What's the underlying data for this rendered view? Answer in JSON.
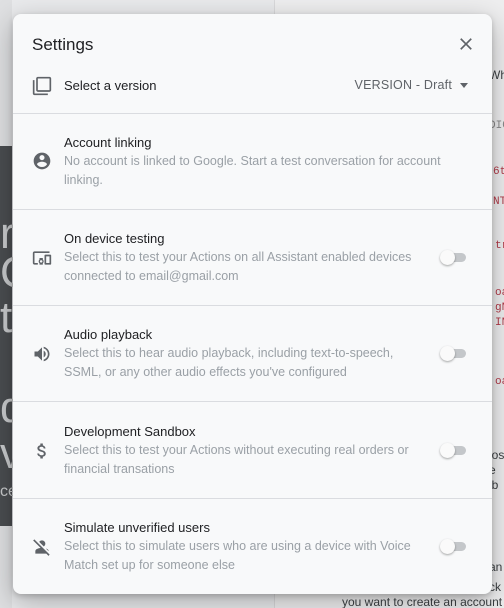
{
  "background": {
    "right_snippets": [
      {
        "text": "Wh",
        "kind": "text"
      },
      {
        "text": "DIC",
        "kind": "code-gray"
      },
      {
        "text": "6t",
        "kind": "code"
      },
      {
        "text": "NT",
        "kind": "code"
      },
      {
        "text": "tr",
        "kind": "code"
      },
      {
        "text": "oa",
        "kind": "code"
      },
      {
        "text": "gN",
        "kind": "code"
      },
      {
        "text": "IN",
        "kind": "code"
      },
      {
        "text": "oa",
        "kind": "code"
      },
      {
        "text": "los",
        "kind": "text"
      },
      {
        "text": "e",
        "kind": "text"
      },
      {
        "text": "t b",
        "kind": "text"
      },
      {
        "text": "an",
        "kind": "text"
      },
      {
        "text": "ck",
        "kind": "text"
      }
    ],
    "bottom_text": "you want to create an account",
    "left_fragments": [
      "r",
      "C",
      "t",
      "d",
      "v",
      "ce"
    ]
  },
  "modal": {
    "title": "Settings",
    "close_icon": "close-icon",
    "version": {
      "label": "Select a version",
      "value": "VERSION - Draft",
      "icon": "versions-icon"
    },
    "items": [
      {
        "key": "account-linking",
        "title": "Account linking",
        "description": "No account is linked to Google. Start a test conversation for account linking.",
        "icon": "account-circle-icon",
        "has_toggle": false
      },
      {
        "key": "on-device-testing",
        "title": "On device testing",
        "description": "Select this to test your Actions on all Assistant enabled devices connected to email@gmail.com",
        "icon": "devices-icon",
        "has_toggle": true,
        "enabled": false
      },
      {
        "key": "audio-playback",
        "title": "Audio playback",
        "description": "Select this to hear audio playback, including text-to-speech, SSML, or any other audio effects you've configured",
        "icon": "volume-icon",
        "has_toggle": true,
        "enabled": false
      },
      {
        "key": "development-sandbox",
        "title": "Development Sandbox",
        "description": "Select this to test your Actions without executing real orders or financial transations",
        "icon": "dollar-icon",
        "has_toggle": true,
        "enabled": false
      },
      {
        "key": "simulate-unverified-users",
        "title": "Simulate unverified users",
        "description": "Select this to simulate users who are using a device with Voice Match set up for someone else",
        "icon": "person-off-icon",
        "has_toggle": true,
        "enabled": false
      }
    ]
  }
}
